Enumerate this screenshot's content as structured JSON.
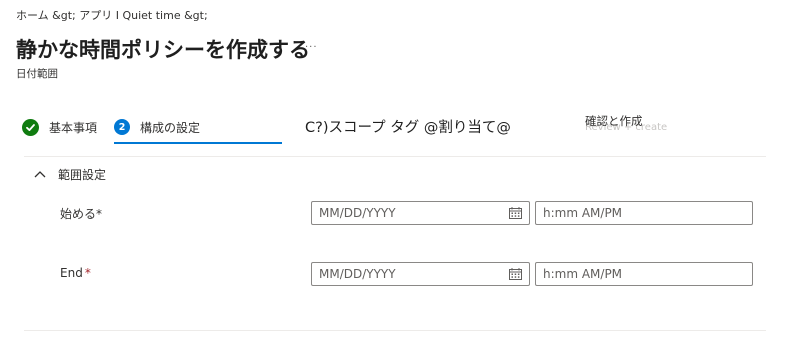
{
  "breadcrumb": {
    "text": "ホーム &gt;  アプリ I Quiet time &gt;"
  },
  "page": {
    "title": "静かな時間ポリシーを作成する",
    "title_more": "···",
    "subtitle": "日付範囲"
  },
  "steps": [
    {
      "label": "基本事項",
      "state": "completed",
      "icon": "checkmark-icon"
    },
    {
      "number": "2",
      "label": "構成の設定",
      "state": "current"
    },
    {
      "label": "C?)スコープ タグ @割り当て@",
      "state": "pending"
    },
    {
      "label": "確認と作成",
      "ghost": "Review + create",
      "state": "pending"
    }
  ],
  "section": {
    "title": "範囲設定",
    "icon": "chevron-up-icon",
    "expanded": true
  },
  "fields": [
    {
      "label": "始める*",
      "required_mark": "",
      "date_placeholder": "MM/DD/YYYY",
      "time_placeholder": "h:mm AM/PM"
    },
    {
      "label": "End",
      "required_mark": "*",
      "date_placeholder": "MM/DD/YYYY",
      "time_placeholder": "h:mm AM/PM"
    }
  ],
  "colors": {
    "accent": "#0078d4",
    "success": "#107c10",
    "required": "#a4262c",
    "border": "#8a8886"
  }
}
